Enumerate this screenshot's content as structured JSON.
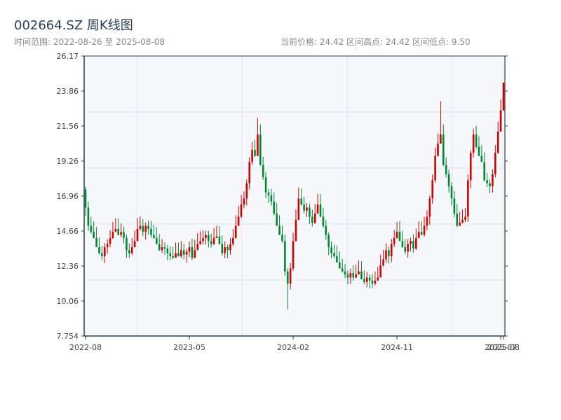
{
  "header": {
    "title": "002664.SZ 周K线图",
    "range_text": "时间范围: 2022-08-26 至 2025-08-08",
    "stats_text": "当前价格: 24.42  区间高点: 24.42  区间低点: 9.50"
  },
  "colors": {
    "up": "#d40000",
    "down": "#008833",
    "plot_bg": "#f5f7fa",
    "grid": "#e1e5ec",
    "axis": "#2c3e50"
  },
  "chart_data": {
    "type": "candlestick",
    "title": "002664.SZ 周K线图",
    "ylim": [
      7.754,
      26.17
    ],
    "y_ticks": [
      "26.17",
      "23.86",
      "21.56",
      "19.26",
      "16.96",
      "14.66",
      "12.36",
      "10.06",
      "7.754"
    ],
    "x_ticks": [
      "2022-08",
      "2023-05",
      "2024-02",
      "2024-11",
      "2025-07",
      "2025-08"
    ],
    "x_tick_weeks": [
      0,
      38,
      76,
      114,
      152,
      153
    ],
    "start_open": 17.4,
    "closes": [
      16.2,
      15.0,
      14.6,
      14.2,
      13.6,
      13.2,
      13.0,
      13.6,
      13.8,
      14.2,
      14.6,
      14.8,
      14.4,
      14.6,
      14.2,
      13.4,
      13.2,
      13.6,
      14.0,
      14.8,
      15.0,
      14.6,
      15.0,
      14.8,
      14.4,
      14.2,
      13.8,
      13.4,
      13.6,
      13.5,
      13.2,
      13.0,
      12.9,
      13.2,
      13.0,
      13.4,
      13.1,
      13.3,
      13.6,
      12.9,
      13.4,
      13.8,
      14.0,
      14.2,
      14.4,
      14.0,
      13.8,
      14.2,
      14.3,
      13.8,
      13.2,
      13.6,
      13.4,
      13.8,
      14.2,
      15.0,
      15.6,
      16.4,
      16.8,
      17.8,
      19.2,
      20.0,
      19.6,
      21.0,
      19.0,
      18.2,
      17.2,
      17.0,
      16.6,
      15.8,
      15.0,
      14.4,
      14.0,
      12.0,
      11.2,
      12.2,
      14.0,
      15.4,
      16.8,
      16.4,
      16.0,
      16.2,
      15.6,
      15.2,
      15.8,
      16.4,
      15.6,
      15.0,
      14.4,
      13.6,
      13.2,
      13.0,
      12.6,
      12.2,
      12.0,
      11.8,
      11.6,
      11.9,
      11.6,
      11.8,
      12.0,
      11.5,
      11.3,
      11.6,
      11.4,
      11.2,
      11.4,
      11.6,
      12.4,
      12.8,
      13.4,
      13.0,
      13.8,
      14.2,
      14.6,
      14.0,
      13.6,
      13.3,
      13.8,
      14.0,
      13.5,
      14.2,
      14.6,
      14.4,
      15.0,
      15.6,
      16.8,
      18.0,
      19.6,
      20.4,
      21.0,
      19.0,
      18.4,
      17.6,
      16.8,
      15.8,
      15.0,
      15.2,
      15.4,
      15.6,
      18.0,
      19.8,
      21.0,
      20.2,
      19.6,
      19.2,
      18.0,
      17.8,
      17.6,
      18.4,
      19.8,
      21.2,
      22.6,
      24.42
    ],
    "low_overrides": {
      "74": 9.5
    },
    "high_overrides": {
      "63": 22.1,
      "130": 23.2,
      "153": 24.42
    }
  }
}
